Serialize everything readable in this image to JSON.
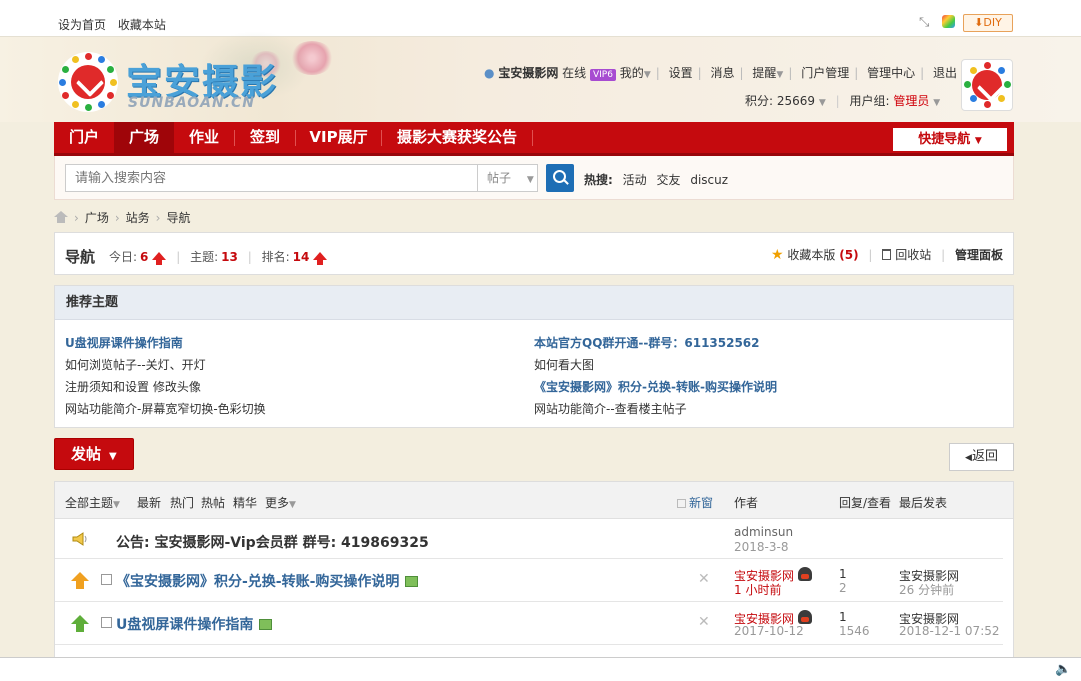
{
  "topbar": {
    "set_home": "设为首页",
    "bookmark": "收藏本站",
    "diy": "DIY"
  },
  "header": {
    "site_name": "宝安摄影",
    "site_name_en": "SUNBAOAN.CN",
    "user": {
      "name": "宝安摄影网",
      "online": "在线",
      "vip": "VIP6",
      "links": [
        "我的",
        "设置",
        "消息",
        "提醒",
        "门户管理",
        "管理中心",
        "退出"
      ],
      "points_label": "积分: 25669",
      "group_label": "用户组:",
      "group_value": "管理员"
    }
  },
  "nav": {
    "items": [
      "门户",
      "广场",
      "作业",
      "签到",
      "VIP展厅",
      "摄影大赛获奖公告"
    ],
    "active": "广场",
    "quick_nav": "快捷导航"
  },
  "search": {
    "placeholder": "请输入搜索内容",
    "type": "帖子",
    "hot_label": "热搜:",
    "hot_words": [
      "活动",
      "交友",
      "discuz"
    ]
  },
  "breadcrumb": [
    "广场",
    "站务",
    "导航"
  ],
  "forum_stats": {
    "title": "导航",
    "today_label": "今日:",
    "today": "6",
    "topics_label": "主题:",
    "topics": "13",
    "rank_label": "排名:",
    "rank": "14",
    "favorite_label": "收藏本版",
    "favorite_count": "(5)",
    "trash_label": "回收站",
    "admin_label": "管理面板"
  },
  "recommended": {
    "heading": "推荐主题",
    "left": [
      "U盘视屏课件操作指南",
      "如何浏览帖子--关灯、开灯",
      "注册须知和设置 修改头像",
      "网站功能简介-屏幕宽窄切换-色彩切换"
    ],
    "right": [
      "本站官方QQ群开通--群号：611352562",
      "如何看大图",
      "《宝安摄影网》积分-兑换-转账-购买操作说明",
      "网站功能简介--查看楼主帖子"
    ]
  },
  "actions": {
    "post": "发帖",
    "back": "返回"
  },
  "thread_list": {
    "filters": [
      "全部主题",
      "最新",
      "热门",
      "热帖",
      "精华",
      "更多"
    ],
    "new_window": "新窗",
    "col_author": "作者",
    "col_replies": "回复/查看",
    "col_last": "最后发表",
    "rows": [
      {
        "type": "announcement",
        "title": "公告: 宝安摄影网-Vip会员群 群号: 419869325",
        "author": "adminsun",
        "date": "2018-3-8"
      },
      {
        "type": "top",
        "title": "《宝安摄影网》积分-兑换-转账-购买操作说明",
        "author": "宝安摄影网",
        "date": "1 小时前",
        "replies": "1",
        "views": "2",
        "last_user": "宝安摄影网",
        "last_time": "26 分钟前"
      },
      {
        "type": "top2",
        "title": "U盘视屏课件操作指南",
        "author": "宝安摄影网",
        "date": "2017-10-12",
        "replies": "1",
        "views": "1546",
        "last_user": "宝安摄影网",
        "last_time": "2018-12-1 07:52"
      }
    ]
  },
  "colors": {
    "nav_red": "#c50a0e",
    "link_blue": "#336699",
    "top_orange": "#f0a020",
    "top_green": "#5fae3a"
  }
}
